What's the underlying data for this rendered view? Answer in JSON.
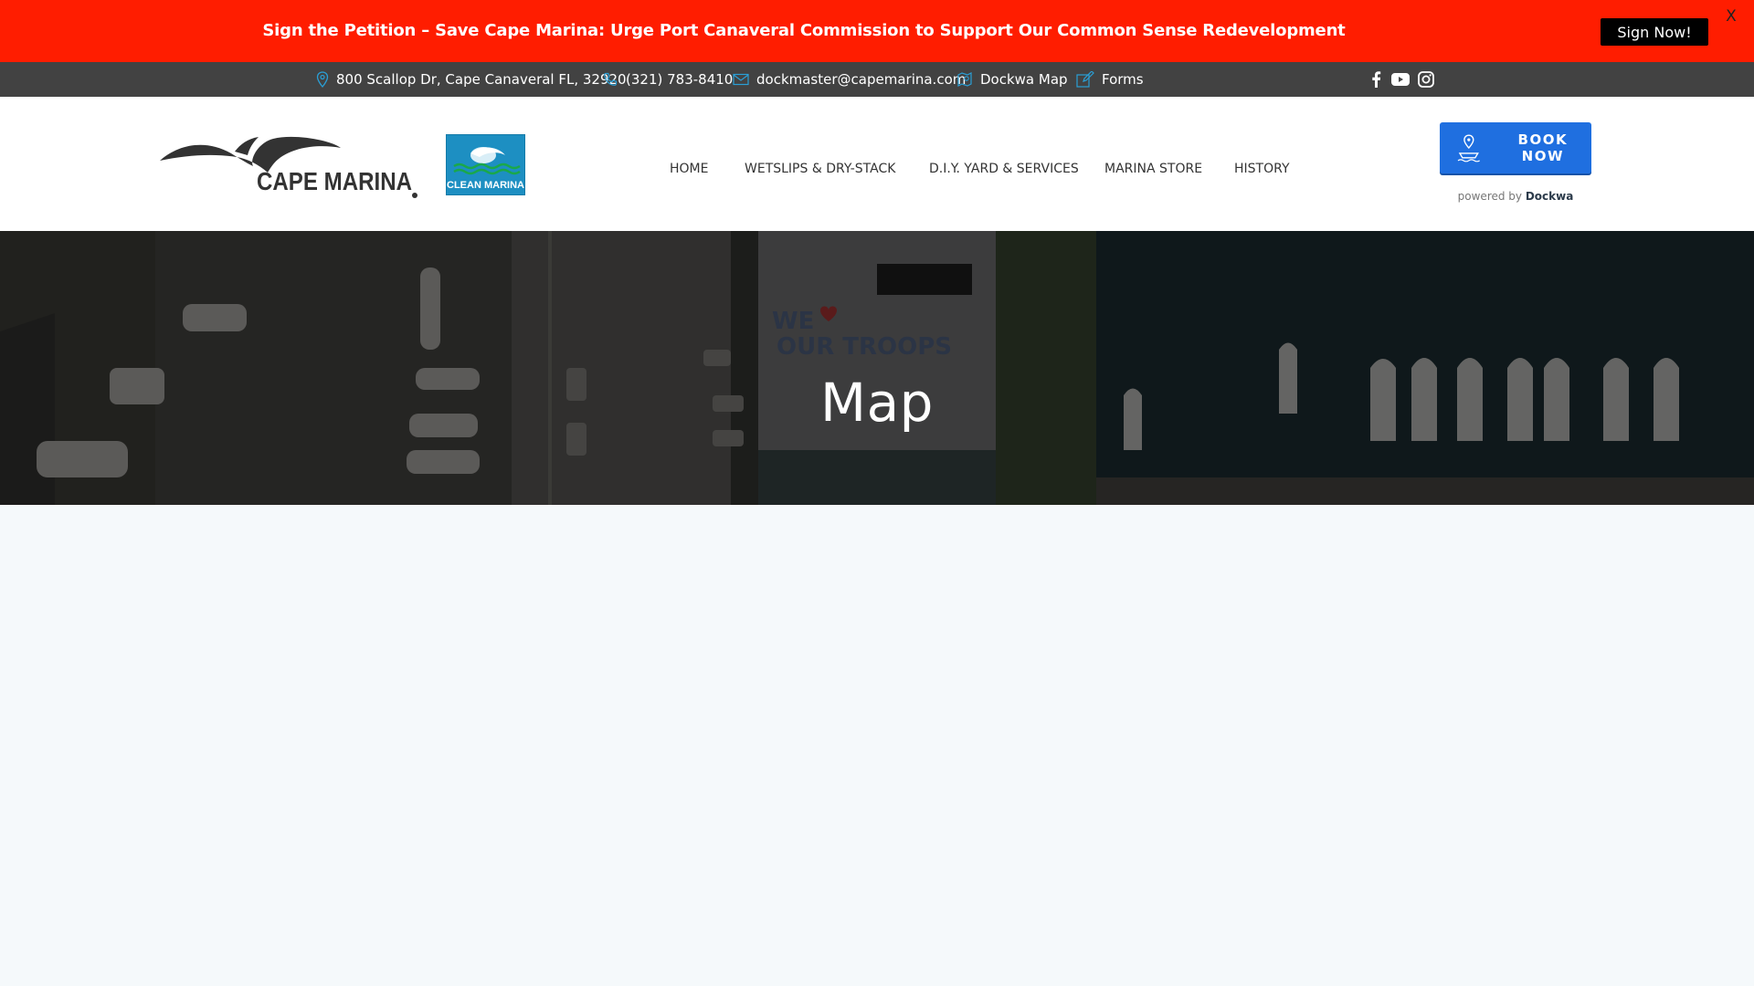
{
  "announcement": {
    "text": "Sign the Petition – Save Cape Marina: Urge Port Canaveral Commission to Support Our Common Sense Redevelopment",
    "button_label": "Sign Now!",
    "close_label": "X",
    "background_color": "#ff1d00"
  },
  "infobar": {
    "address": "800 Scallop Dr, Cape Canaveral FL, 32920",
    "phone": "(321) 783-8410",
    "email": "dockmaster@capemarina.com",
    "dockwa_map": "Dockwa Map",
    "forms": "Forms",
    "icon_color": "#2a9fd6",
    "social": [
      "facebook-icon",
      "youtube-icon",
      "instagram-icon"
    ]
  },
  "header": {
    "logo_text": "CAPE MARINA",
    "clean_marina_text": "CLEAN MARINA",
    "nav": [
      "HOME",
      "WETSLIPS & DRY-STACK",
      "D.I.Y. YARD & SERVICES",
      "MARINA STORE",
      "HISTORY"
    ],
    "book_label": "BOOK NOW",
    "powered_prefix": "powered by",
    "powered_brand": "Dockwa",
    "accent_color": "#1f6fe0"
  },
  "hero": {
    "title": "Map",
    "building_sign_line1": "WE",
    "building_sign_line2": "OUR TROOPS"
  }
}
